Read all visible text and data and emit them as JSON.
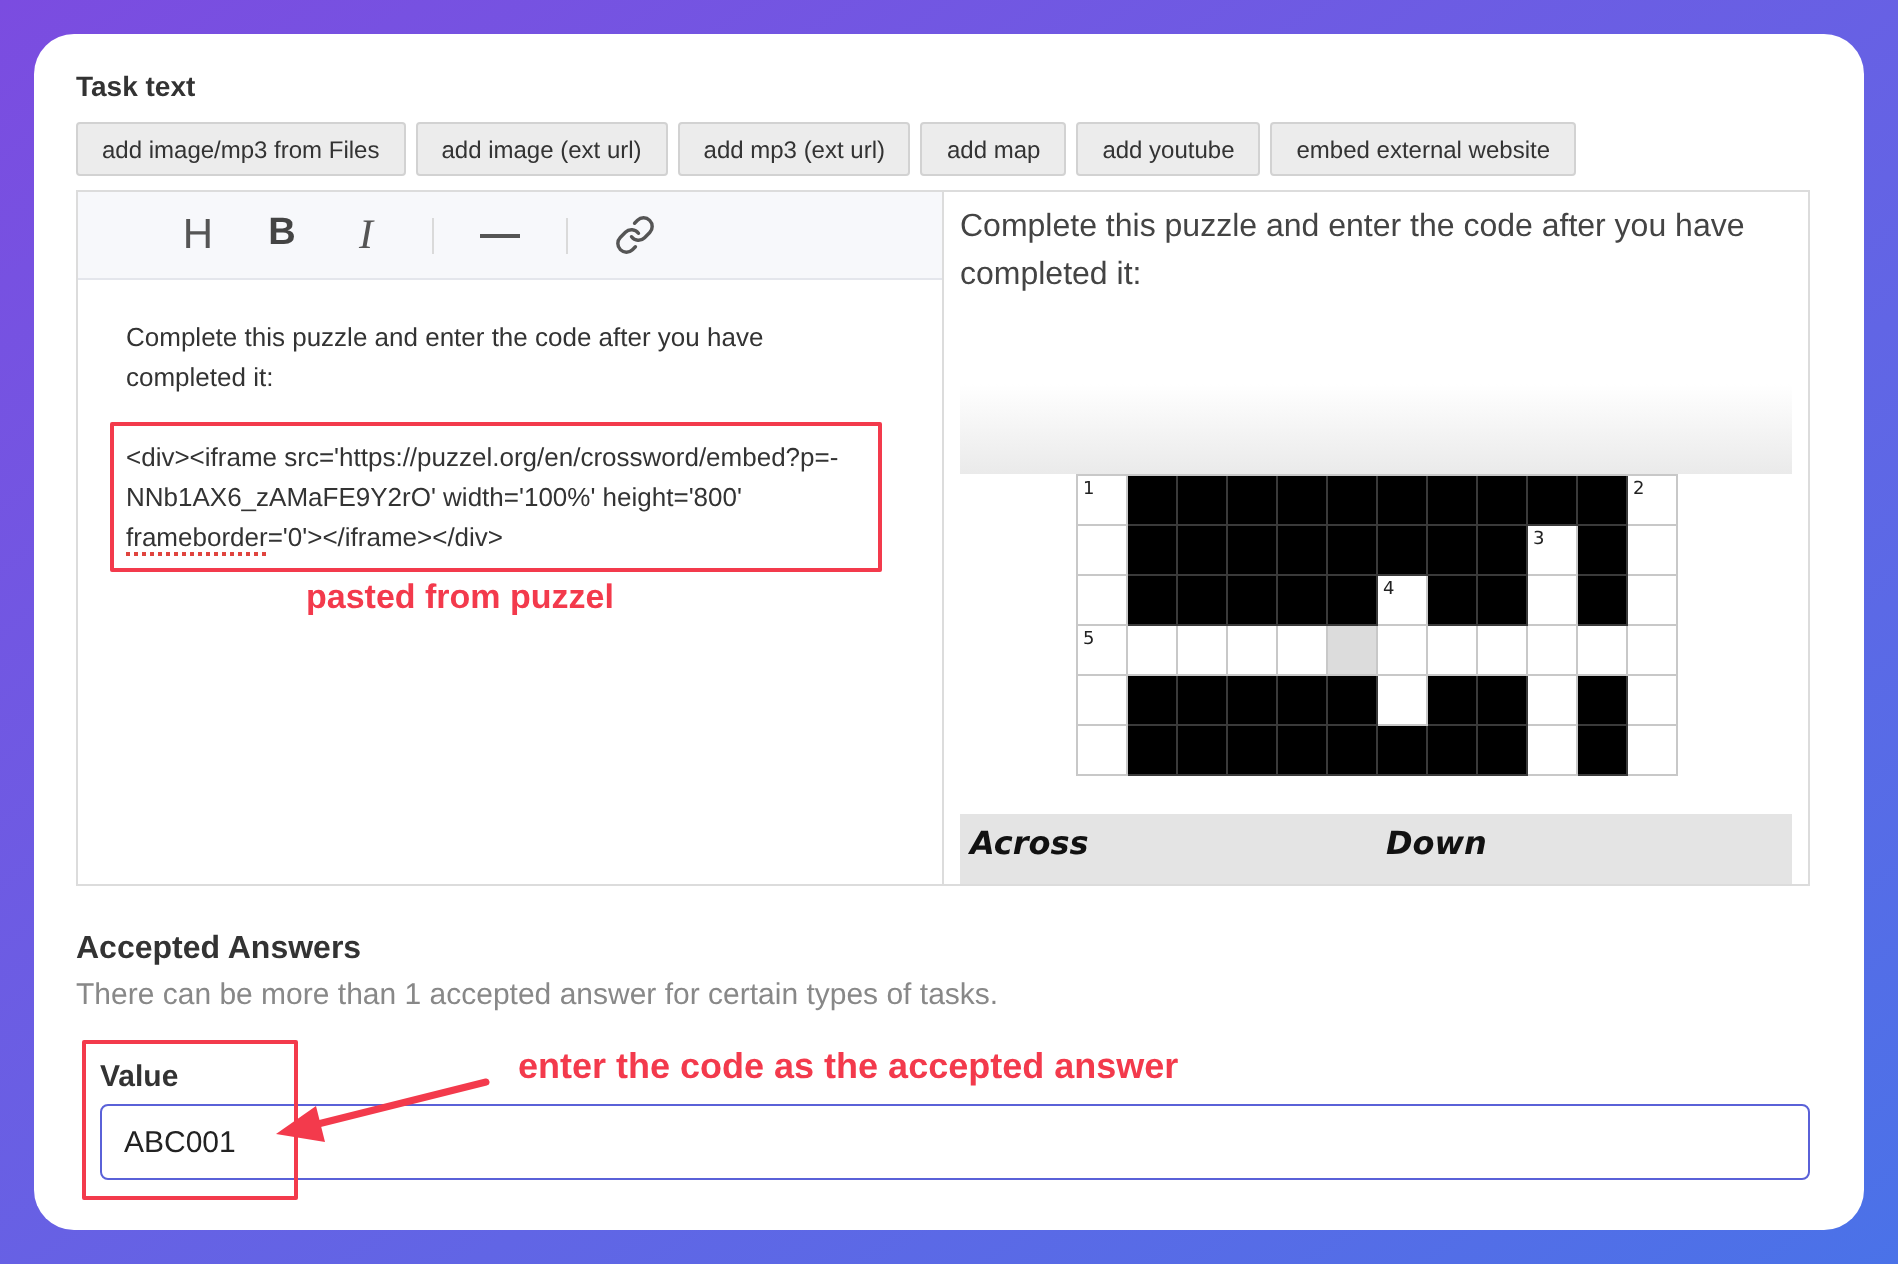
{
  "task_text": {
    "label": "Task text",
    "insert_buttons": [
      "add image/mp3 from Files",
      "add image (ext url)",
      "add mp3 (ext url)",
      "add map",
      "add youtube",
      "embed external website"
    ]
  },
  "editor": {
    "toolbar": [
      {
        "kind": "heading",
        "label": "H"
      },
      {
        "kind": "bold",
        "label": "B"
      },
      {
        "kind": "italic",
        "label": "I"
      },
      {
        "kind": "separator"
      },
      {
        "kind": "rule"
      },
      {
        "kind": "separator"
      },
      {
        "kind": "link"
      }
    ],
    "paragraph": "Complete this puzzle and enter the code after you have completed it:",
    "code_segments": [
      {
        "text": "<div><iframe src='https://puzzel.org/en/crossword/embed?p=-NNb1AX6_zAMaFE9Y2rO' width='100%' height='800' ",
        "misspelled": false
      },
      {
        "text": "frameborder",
        "misspelled": true
      },
      {
        "text": "='0'></iframe></div>",
        "misspelled": false
      }
    ],
    "annotation": "pasted from puzzel"
  },
  "preview": {
    "paragraph": "Complete this puzzle and enter the code after you have completed it:",
    "crossword": {
      "rows": [
        [
          {
            "kind": "open",
            "number": "1"
          },
          {
            "kind": "block"
          },
          {
            "kind": "block"
          },
          {
            "kind": "block"
          },
          {
            "kind": "block"
          },
          {
            "kind": "block"
          },
          {
            "kind": "block"
          },
          {
            "kind": "block"
          },
          {
            "kind": "block"
          },
          {
            "kind": "block"
          },
          {
            "kind": "block"
          },
          {
            "kind": "open",
            "number": "2"
          }
        ],
        [
          {
            "kind": "open"
          },
          {
            "kind": "block"
          },
          {
            "kind": "block"
          },
          {
            "kind": "block"
          },
          {
            "kind": "block"
          },
          {
            "kind": "block"
          },
          {
            "kind": "block"
          },
          {
            "kind": "block"
          },
          {
            "kind": "block"
          },
          {
            "kind": "open",
            "number": "3"
          },
          {
            "kind": "block"
          },
          {
            "kind": "open"
          }
        ],
        [
          {
            "kind": "open"
          },
          {
            "kind": "block"
          },
          {
            "kind": "block"
          },
          {
            "kind": "block"
          },
          {
            "kind": "block"
          },
          {
            "kind": "block"
          },
          {
            "kind": "open",
            "number": "4"
          },
          {
            "kind": "block"
          },
          {
            "kind": "block"
          },
          {
            "kind": "open"
          },
          {
            "kind": "block"
          },
          {
            "kind": "open"
          }
        ],
        [
          {
            "kind": "open",
            "number": "5"
          },
          {
            "kind": "open"
          },
          {
            "kind": "open"
          },
          {
            "kind": "open"
          },
          {
            "kind": "open"
          },
          {
            "kind": "active"
          },
          {
            "kind": "open"
          },
          {
            "kind": "open"
          },
          {
            "kind": "open"
          },
          {
            "kind": "open"
          },
          {
            "kind": "open"
          },
          {
            "kind": "open"
          }
        ],
        [
          {
            "kind": "open"
          },
          {
            "kind": "block"
          },
          {
            "kind": "block"
          },
          {
            "kind": "block"
          },
          {
            "kind": "block"
          },
          {
            "kind": "block"
          },
          {
            "kind": "open"
          },
          {
            "kind": "block"
          },
          {
            "kind": "block"
          },
          {
            "kind": "open"
          },
          {
            "kind": "block"
          },
          {
            "kind": "open"
          }
        ],
        [
          {
            "kind": "open"
          },
          {
            "kind": "block"
          },
          {
            "kind": "block"
          },
          {
            "kind": "block"
          },
          {
            "kind": "block"
          },
          {
            "kind": "block"
          },
          {
            "kind": "block"
          },
          {
            "kind": "block"
          },
          {
            "kind": "block"
          },
          {
            "kind": "open"
          },
          {
            "kind": "block"
          },
          {
            "kind": "open"
          }
        ]
      ]
    },
    "clue_headings": [
      "Across",
      "Down"
    ]
  },
  "accepted_answers": {
    "heading": "Accepted Answers",
    "help": "There can be more than 1 accepted answer for certain types of tasks.",
    "field": {
      "label": "Value",
      "value": "ABC001",
      "focused": true
    },
    "annotation": "enter the code as the accepted answer"
  }
}
